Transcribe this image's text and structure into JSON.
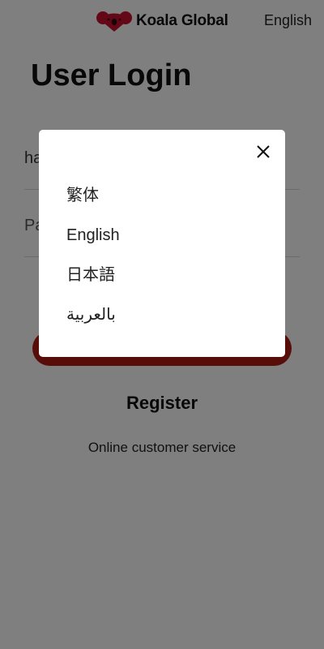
{
  "header": {
    "brand_name": "Koala Global",
    "brand_logo": "koala-heart-logo",
    "language_label": "English"
  },
  "login": {
    "title": "User Login",
    "username_value": "ha",
    "password_placeholder": "Pa",
    "register_label": "Register",
    "customer_service_label": "Online customer service"
  },
  "language_modal": {
    "close_icon": "close-icon",
    "options": [
      {
        "label": "繁体"
      },
      {
        "label": "English"
      },
      {
        "label": "日本語"
      },
      {
        "label": "بالعربية"
      }
    ]
  },
  "colors": {
    "brand_red": "#b01c10",
    "logo_red": "#c8102e",
    "overlay": "rgba(0,0,0,0.5)"
  }
}
